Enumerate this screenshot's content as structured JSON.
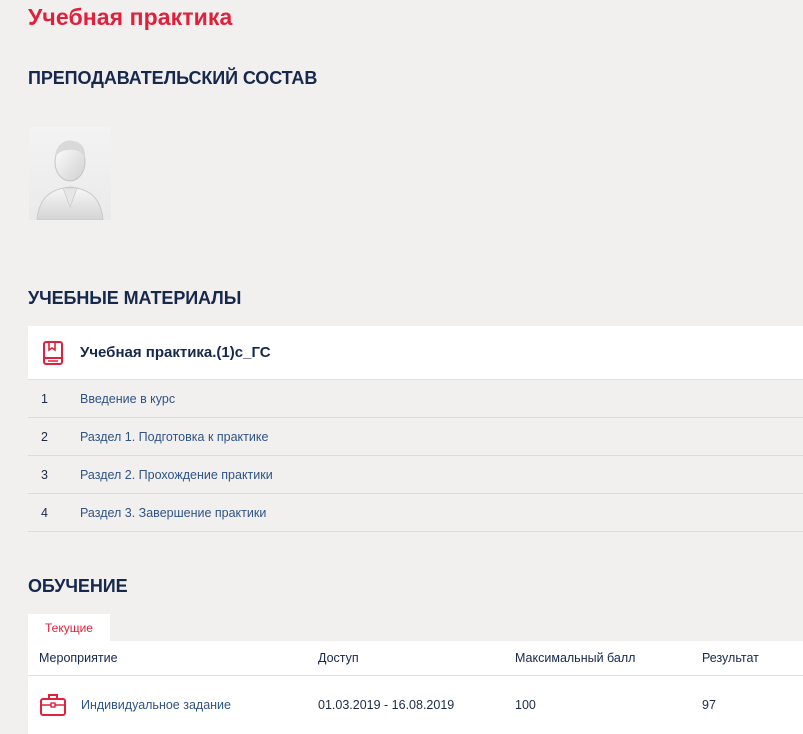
{
  "page": {
    "title": "Учебная практика"
  },
  "teachers": {
    "heading": "ПРЕПОДАВАТЕЛЬСКИЙ СОСТАВ",
    "avatar_icon": "user-placeholder-icon"
  },
  "materials": {
    "heading": "УЧЕБНЫЕ МАТЕРИАЛЫ",
    "course": {
      "icon": "book-icon",
      "title": "Учебная практика.(1)с_ГС"
    },
    "items": [
      {
        "num": "1",
        "label": "Введение в курс"
      },
      {
        "num": "2",
        "label": "Раздел 1. Подготовка к практике"
      },
      {
        "num": "3",
        "label": "Раздел 2. Прохождение практики"
      },
      {
        "num": "4",
        "label": "Раздел 3. Завершение практики"
      }
    ]
  },
  "learning": {
    "heading": "ОБУЧЕНИЕ",
    "tab_current": "Текущие",
    "columns": {
      "event": "Мероприятие",
      "access": "Доступ",
      "max_score": "Максимальный балл",
      "result": "Результат"
    },
    "rows": [
      {
        "icon": "briefcase-icon",
        "event": "Индивидуальное задание",
        "access": "01.03.2019 - 16.08.2019",
        "max_score": "100",
        "result": "97"
      }
    ]
  },
  "colors": {
    "accent_red": "#e0203d",
    "heading_navy": "#16284c",
    "link_blue": "#2f5385",
    "background": "#f2f0ee"
  }
}
